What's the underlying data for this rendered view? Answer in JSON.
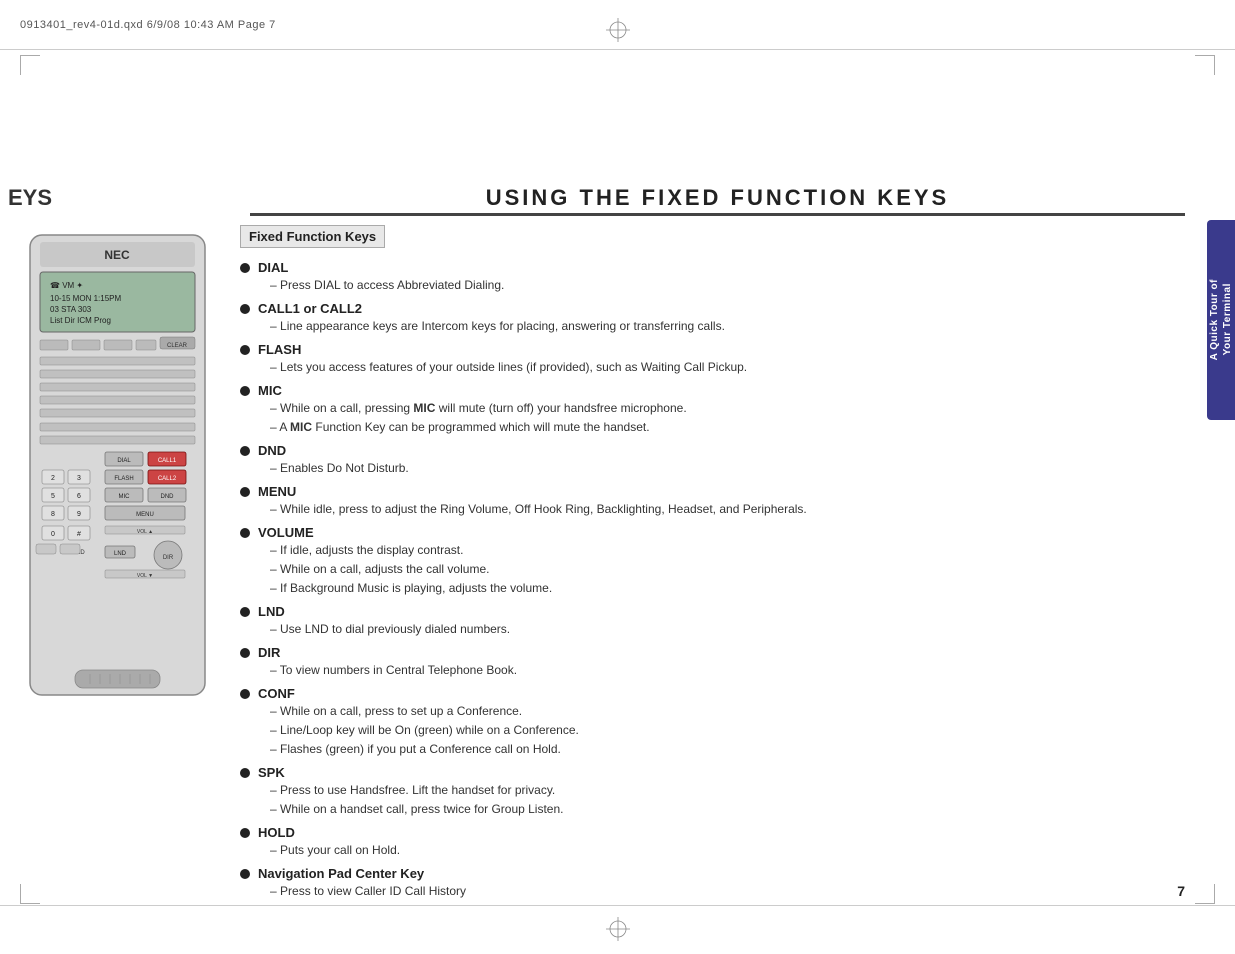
{
  "header": {
    "file_info": "0913401_rev4-01d.qxd   6/9/08   10:43 AM   Page 7"
  },
  "page_title": "Using The Fixed Function Keys",
  "left_label": "EYS",
  "right_tab": {
    "line1": "A Quick Tour of",
    "line2": "Your Terminal"
  },
  "section_heading": "Fixed Function Keys",
  "items": [
    {
      "title": "DIAL",
      "descriptions": [
        "Press DIAL to access Abbreviated Dialing."
      ]
    },
    {
      "title": "CALL1 or CALL2",
      "descriptions": [
        "Line appearance keys are Intercom keys for placing, answering or transferring calls."
      ]
    },
    {
      "title": "FLASH",
      "descriptions": [
        "Lets you access features of your outside lines (if provided), such as Waiting Call Pickup."
      ]
    },
    {
      "title": "MIC",
      "descriptions": [
        "While on a call, pressing MIC will mute (turn off) your handsfree microphone.",
        "A MIC Function Key can be programmed which will mute the handset."
      ]
    },
    {
      "title": "DND",
      "descriptions": [
        "Enables Do Not Disturb."
      ]
    },
    {
      "title": "MENU",
      "descriptions": [
        "While idle, press to adjust the Ring Volume, Off Hook Ring, Backlighting, Headset, and Peripherals."
      ]
    },
    {
      "title": "VOLUME",
      "descriptions": [
        "If idle, adjusts the display contrast.",
        "While on a call, adjusts the call volume.",
        "If Background Music is playing, adjusts the volume."
      ]
    },
    {
      "title": "LND",
      "descriptions": [
        "Use LND to dial previously dialed numbers."
      ]
    },
    {
      "title": "DIR",
      "descriptions": [
        "To view numbers in Central Telephone Book."
      ]
    },
    {
      "title": "CONF",
      "descriptions": [
        "While on a call, press to set up a Conference.",
        "Line/Loop key will be On (green) while on a Conference.",
        "Flashes (green) if you put a Conference call on Hold."
      ]
    },
    {
      "title": "SPK",
      "descriptions": [
        "Press to use Handsfree. Lift the handset for privacy.",
        "While on a handset call, press twice for Group Listen."
      ]
    },
    {
      "title": "HOLD",
      "descriptions": [
        "Puts your call on Hold."
      ]
    },
    {
      "title": "Navigation Pad Center Key",
      "descriptions": [
        "Press to view Caller ID Call History"
      ]
    }
  ],
  "page_number": "7"
}
